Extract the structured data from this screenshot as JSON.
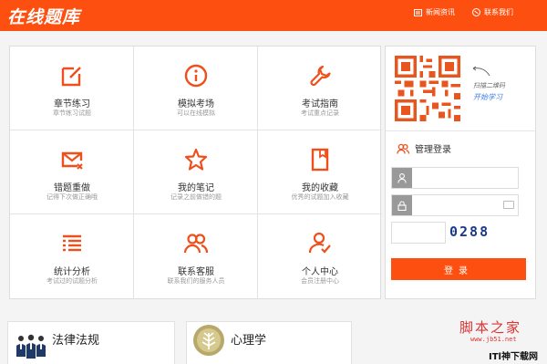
{
  "header": {
    "logo": "在线题库",
    "links": [
      {
        "label": "新闻资讯",
        "icon": "news-icon"
      },
      {
        "label": "联系我们",
        "icon": "contact-icon"
      }
    ]
  },
  "grid": {
    "items": [
      {
        "title": "章节练习",
        "subtitle": "章节练习试题",
        "icon": "edit-icon"
      },
      {
        "title": "模拟考场",
        "subtitle": "可以在线模拟",
        "icon": "info-icon"
      },
      {
        "title": "考试指南",
        "subtitle": "考试重点记录",
        "icon": "wrench-icon"
      },
      {
        "title": "错题重做",
        "subtitle": "记得下次做正确哦",
        "icon": "mail-error-icon"
      },
      {
        "title": "我的笔记",
        "subtitle": "记录之前做错的题",
        "icon": "star-icon"
      },
      {
        "title": "我的收藏",
        "subtitle": "优秀的试题加入收藏",
        "icon": "bookmark-icon"
      },
      {
        "title": "统计分析",
        "subtitle": "考试过的试题分析",
        "icon": "list-icon"
      },
      {
        "title": "联系客服",
        "subtitle": "联系我们的服务人员",
        "icon": "users-icon"
      },
      {
        "title": "个人中心",
        "subtitle": "会员注册中心",
        "icon": "user-check-icon"
      }
    ]
  },
  "sidebar": {
    "qr_caption": "扫描二维码",
    "qr_sub": "开始学习",
    "login_title": "管理登录",
    "username_placeholder": "",
    "password_placeholder": "",
    "captcha": "0288",
    "login_button": "登录"
  },
  "panels": [
    {
      "title": "法律法规"
    },
    {
      "title": "心理学"
    }
  ],
  "watermark": {
    "line1": "脚本之家",
    "line2": "www.jb51.net",
    "line3": "ITl神下载网"
  },
  "colors": {
    "accent": "#fd4f0f",
    "link": "#3e7ce5"
  }
}
